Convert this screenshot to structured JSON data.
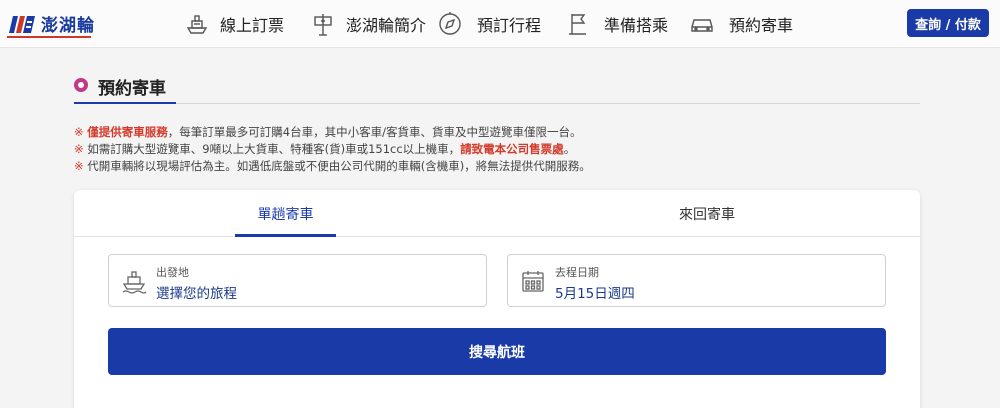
{
  "header": {
    "logo_text": "澎湖輪",
    "nav": [
      {
        "label": "線上訂票",
        "icon": "ship-ticket-icon"
      },
      {
        "label": "澎湖輪簡介",
        "icon": "signpost-icon"
      },
      {
        "label": "預訂行程",
        "icon": "compass-icon"
      },
      {
        "label": "準備搭乘",
        "icon": "flag-icon"
      },
      {
        "label": "預約寄車",
        "icon": "car-icon"
      }
    ],
    "query_button": "查詢 / 付款"
  },
  "page": {
    "title": "預約寄車"
  },
  "notes": [
    {
      "mark": "※",
      "highlight": "僅提供寄車服務",
      "text": "，每筆訂單最多可訂購4台車，其中小客車/客貨車、貨車及中型遊覽車僅限一台。"
    },
    {
      "mark": "※",
      "text": "如需訂購大型遊覽車、9噸以上大貨車、特種客(貨)車或151cc以上機車，",
      "highlight": "請致電本公司售票處",
      "suffix": "。"
    },
    {
      "mark": "※",
      "text": "代開車輛將以現場評估為主。如遇低底盤或不便由公司代開的車輛(含機車)，將無法提供代開服務。"
    }
  ],
  "tabs": [
    {
      "label": "單趟寄車",
      "active": true
    },
    {
      "label": "來回寄車",
      "active": false
    }
  ],
  "fields": {
    "departure": {
      "label": "出發地",
      "value": "選擇您的旅程",
      "icon": "ship-icon"
    },
    "date": {
      "label": "去程日期",
      "value": "5月15日週四",
      "icon": "calendar-icon"
    }
  },
  "search_button": "搜尋航班",
  "colors": {
    "brand_blue": "#1a3aa8",
    "accent_red": "#d43a2a",
    "accent_pink": "#c23a88"
  }
}
